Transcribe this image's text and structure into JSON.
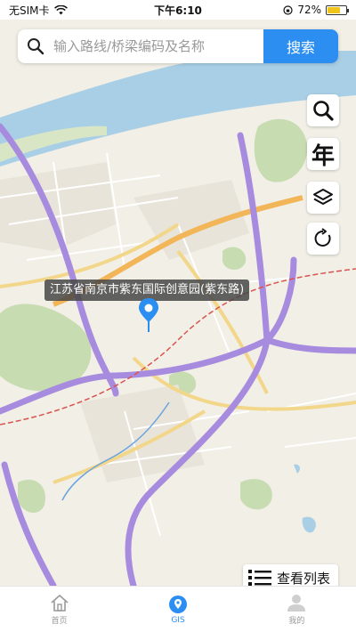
{
  "status_bar": {
    "carrier": "无SIM卡",
    "time": "下午6:10",
    "battery_percent": "72%",
    "battery_level": 0.72
  },
  "search": {
    "placeholder": "输入路线/桥梁编码及名称",
    "button_label": "搜索"
  },
  "tools": {
    "year_label": "年"
  },
  "map": {
    "location_label": "江苏省南京市紫东国际创意园(紫东路)"
  },
  "list_button": {
    "label": "查看列表"
  },
  "tabs": [
    {
      "label": "首页",
      "icon": "home-icon",
      "active": false
    },
    {
      "label": "GIS",
      "icon": "location-icon",
      "active": true
    },
    {
      "label": "我的",
      "icon": "user-icon",
      "active": false
    }
  ],
  "colors": {
    "accent": "#2b8ef0",
    "expressway": "#a78bdf",
    "arterial": "#f2b558",
    "water": "#a9cfe6",
    "green": "#c7dcb1"
  }
}
